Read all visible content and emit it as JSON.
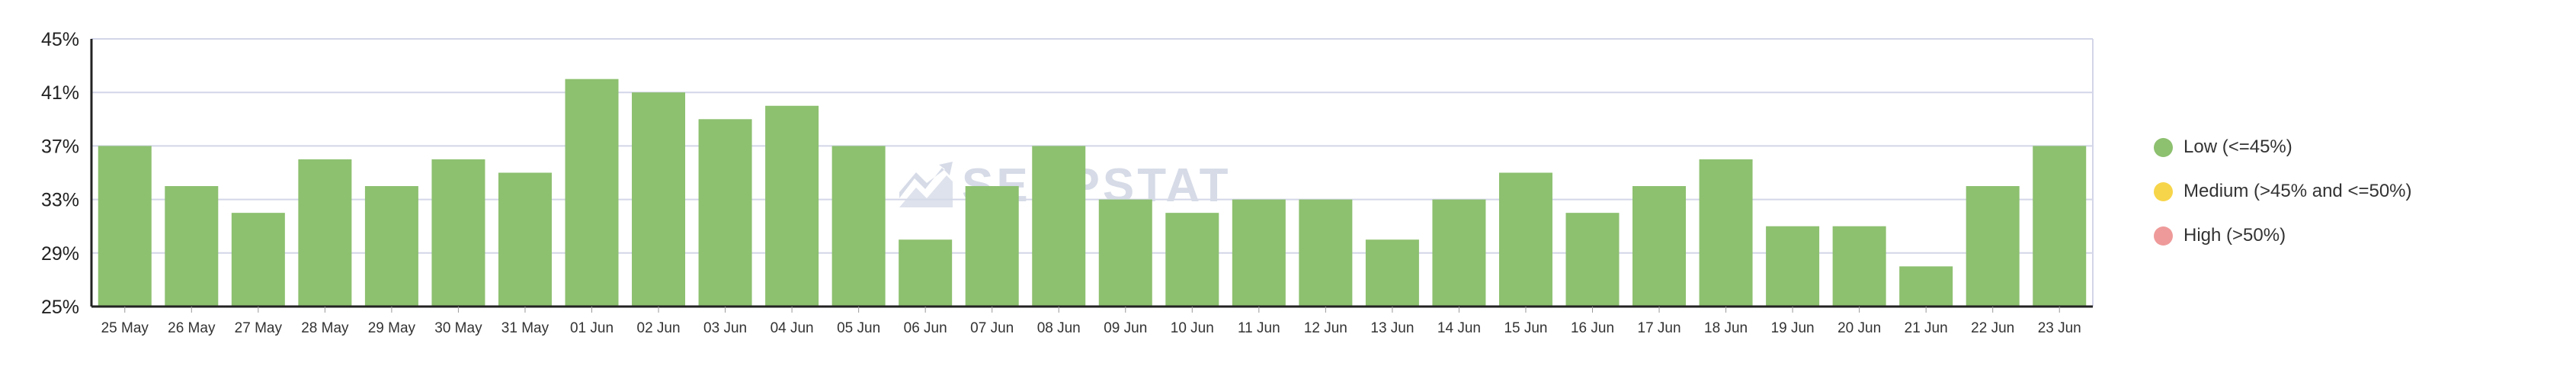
{
  "colors": {
    "low": "#8dc06f",
    "medium": "#f7d54a",
    "high": "#ef9a9a",
    "axis": "#222222",
    "grid": "#d3d6e8",
    "watermark": "#d6dbe7"
  },
  "watermark": "SERPSTAT",
  "legend": [
    {
      "label": "Low (<=45%)",
      "color": "#8dc06f"
    },
    {
      "label": "Medium (>45% and <=50%)",
      "color": "#f7d54a"
    },
    {
      "label": "High (>50%)",
      "color": "#ef9a9a"
    }
  ],
  "chart_data": {
    "type": "bar",
    "categories": [
      "25 May",
      "26 May",
      "27 May",
      "28 May",
      "29 May",
      "30 May",
      "31 May",
      "01 Jun",
      "02 Jun",
      "03 Jun",
      "04 Jun",
      "05 Jun",
      "06 Jun",
      "07 Jun",
      "08 Jun",
      "09 Jun",
      "10 Jun",
      "11 Jun",
      "12 Jun",
      "13 Jun",
      "14 Jun",
      "15 Jun",
      "16 Jun",
      "17 Jun",
      "18 Jun",
      "19 Jun",
      "20 Jun",
      "21 Jun",
      "22 Jun",
      "23 Jun"
    ],
    "values": [
      37,
      34,
      32,
      36,
      34,
      36,
      35,
      42,
      41,
      39,
      40,
      37,
      30,
      34,
      37,
      33,
      32,
      33,
      33,
      30,
      33,
      35,
      32,
      34,
      36,
      31,
      31,
      28,
      34,
      37
    ],
    "ylim": [
      25,
      45
    ],
    "yticks": [
      25,
      29,
      33,
      37,
      41,
      45
    ],
    "ytick_labels": [
      "25%",
      "29%",
      "33%",
      "37%",
      "41%",
      "45%"
    ],
    "grid": true,
    "legend_position": "right",
    "bar_color": "#8dc06f"
  }
}
